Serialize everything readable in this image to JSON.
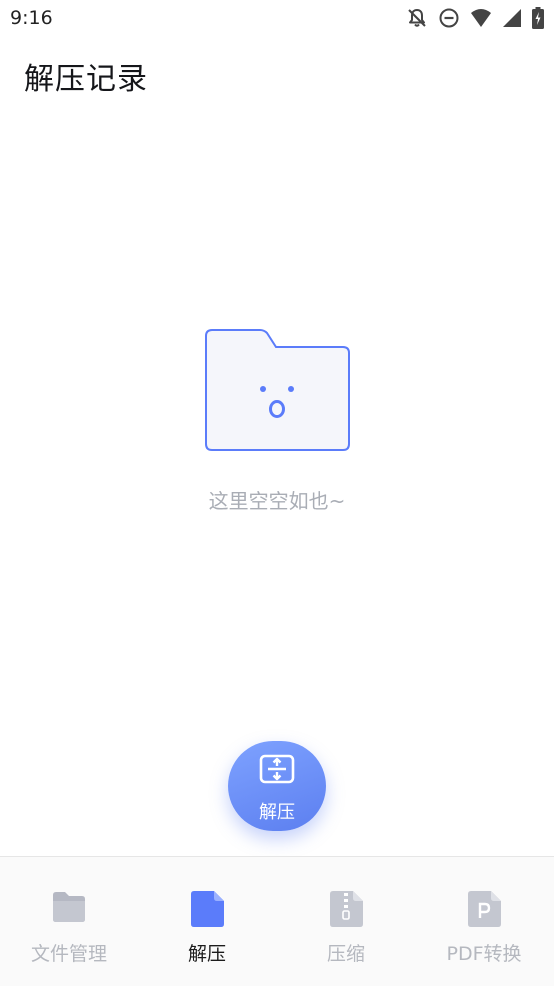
{
  "status_bar": {
    "time": "9:16",
    "icons": [
      "notifications-off-icon",
      "do-not-disturb-icon",
      "wifi-icon",
      "cellular-signal-icon",
      "battery-charging-icon"
    ]
  },
  "header": {
    "title": "解压记录"
  },
  "empty_state": {
    "icon": "empty-folder-icon",
    "message": "这里空空如也~"
  },
  "fab": {
    "label": "解压",
    "icon": "extract-icon"
  },
  "bottom_nav": {
    "active_index": 1,
    "items": [
      {
        "label": "文件管理",
        "icon": "folder-icon"
      },
      {
        "label": "解压",
        "icon": "document-icon"
      },
      {
        "label": "压缩",
        "icon": "zip-file-icon"
      },
      {
        "label": "PDF转换",
        "icon": "pdf-file-icon"
      }
    ]
  },
  "colors": {
    "accent": "#5b7cfa",
    "inactive": "#b5b8bf",
    "empty_text": "#a9adb5",
    "background": "#ffffff",
    "nav_background": "#fafafa"
  }
}
